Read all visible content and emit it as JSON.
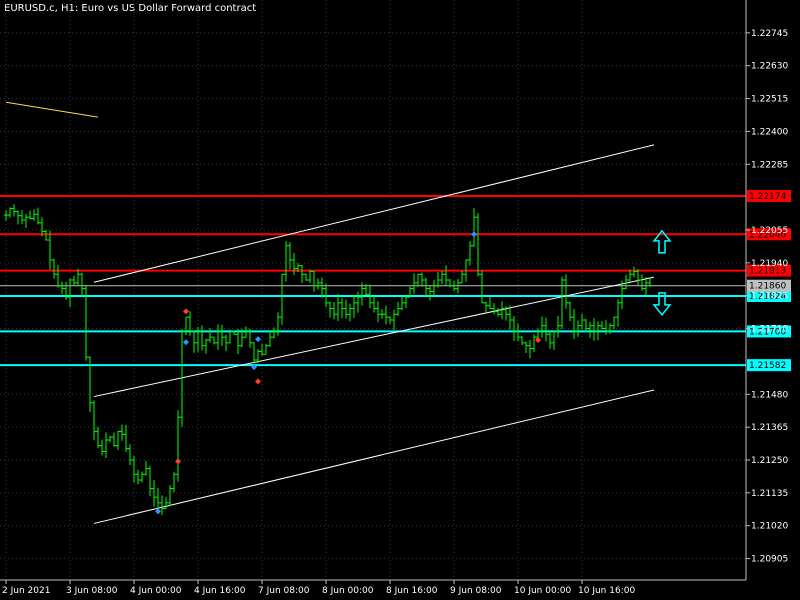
{
  "window": {
    "title": "EURUSD.c, H1:  Euro vs US Dollar Forward contract"
  },
  "colors": {
    "background": "#000000",
    "grid": "#3a3a3a",
    "candles": "#00ff00",
    "resistance": "#ff0000",
    "support": "#00ffff",
    "channel": "#ffffff",
    "bid": "#c0c0c0",
    "yellow_line": "#ffd54a",
    "arrow_up": "#00ffff",
    "arrow_down": "#00ffff",
    "fractal_up": "#ff4020",
    "fractal_down": "#3090ff"
  },
  "chart_data": {
    "type": "candlestick",
    "symbol": "EURUSD.c",
    "timeframe": "H1",
    "ylim": [
      1.2083,
      1.2286
    ],
    "y_ticks": [
      "1.22745",
      "1.22630",
      "1.22515",
      "1.22400",
      "1.22285",
      "1.22055",
      "1.21940",
      "1.21825",
      "1.21710",
      "1.21480",
      "1.21365",
      "1.21250",
      "1.21135",
      "1.21020",
      "1.20905"
    ],
    "x_ticks": [
      "2 Jun 2021",
      "3 Jun 08:00",
      "4 Jun 00:00",
      "4 Jun 16:00",
      "7 Jun 08:00",
      "8 Jun 00:00",
      "8 Jun 16:00",
      "9 Jun 08:00",
      "10 Jun 00:00",
      "10 Jun 16:00"
    ],
    "x_ticks_bars": [
      0,
      16,
      32,
      48,
      64,
      80,
      96,
      112,
      128,
      144
    ],
    "horizontal_levels": [
      {
        "value": 1.22174,
        "label": "1.22174",
        "kind": "resistance"
      },
      {
        "value": 1.2204,
        "label": "1.22040",
        "kind": "resistance"
      },
      {
        "value": 1.21913,
        "label": "1.21913",
        "kind": "resistance"
      },
      {
        "value": 1.21824,
        "label": "1.21824",
        "kind": "support"
      },
      {
        "value": 1.217,
        "label": "1.21700",
        "kind": "support"
      },
      {
        "value": 1.21582,
        "label": "1.21582",
        "kind": "support"
      }
    ],
    "current_price": {
      "value": 1.2186,
      "label": "1.21860"
    },
    "channel_lines": [
      {
        "bars": [
          22,
          162
        ],
        "values": [
          1.21872,
          1.22353
        ]
      },
      {
        "bars": [
          22,
          162
        ],
        "values": [
          1.21472,
          1.2189
        ]
      },
      {
        "bars": [
          22,
          162
        ],
        "values": [
          1.21028,
          1.21495
        ]
      }
    ],
    "yellow_line": {
      "bars": [
        0,
        23
      ],
      "values": [
        1.22502,
        1.2245
      ]
    },
    "arrows": [
      {
        "direction": "up",
        "bar": 164,
        "value": 1.2201
      },
      {
        "direction": "down",
        "bar": 164,
        "value": 1.218
      }
    ],
    "fractals_up": [
      {
        "bar": 45,
        "value": 1.2177
      },
      {
        "bar": 43,
        "value": 1.21245
      },
      {
        "bar": 63,
        "value": 1.21525
      },
      {
        "bar": 133,
        "value": 1.2167
      }
    ],
    "fractals_down": [
      {
        "bar": 38,
        "value": 1.2107
      },
      {
        "bar": 45,
        "value": 1.21662
      },
      {
        "bar": 62,
        "value": 1.21575
      },
      {
        "bar": 63,
        "value": 1.21673
      },
      {
        "bar": 117,
        "value": 1.2204
      }
    ],
    "closes": [
      1.22107,
      1.2213,
      1.2212,
      1.22105,
      1.2209,
      1.221,
      1.22095,
      1.2211,
      1.2208,
      1.2205,
      1.2202,
      1.2195,
      1.219,
      1.2186,
      1.2185,
      1.2182,
      1.2188,
      1.2187,
      1.219,
      1.2185,
      1.2161,
      1.2145,
      1.2135,
      1.213,
      1.2128,
      1.2132,
      1.2133,
      1.213,
      1.2135,
      1.2134,
      1.2129,
      1.2125,
      1.212,
      1.2118,
      1.212,
      1.2122,
      1.2115,
      1.2112,
      1.211,
      1.2108,
      1.211,
      1.2115,
      1.212,
      1.214,
      1.217,
      1.2175,
      1.217,
      1.2166,
      1.217,
      1.2165,
      1.2167,
      1.2168,
      1.2166,
      1.217,
      1.2168,
      1.2166,
      1.217,
      1.2169,
      1.2165,
      1.2168,
      1.217,
      1.2166,
      1.216,
      1.2163,
      1.2162,
      1.2165,
      1.2168,
      1.217,
      1.2175,
      1.219,
      1.22,
      1.2195,
      1.2192,
      1.2193,
      1.219,
      1.2188,
      1.2191,
      1.2186,
      1.2187,
      1.2185,
      1.218,
      1.2178,
      1.2176,
      1.218,
      1.2178,
      1.2176,
      1.2178,
      1.218,
      1.2182,
      1.2185,
      1.2183,
      1.218,
      1.2178,
      1.2176,
      1.2176,
      1.2175,
      1.2174,
      1.2176,
      1.2178,
      1.218,
      1.2182,
      1.2185,
      1.2187,
      1.219,
      1.2188,
      1.2185,
      1.2184,
      1.2186,
      1.2188,
      1.219,
      1.2188,
      1.2186,
      1.2185,
      1.2187,
      1.219,
      1.2195,
      1.22,
      1.221,
      1.219,
      1.218,
      1.2179,
      1.2178,
      1.2177,
      1.2176,
      1.2178,
      1.2176,
      1.2174,
      1.217,
      1.2168,
      1.2166,
      1.2165,
      1.2164,
      1.2168,
      1.217,
      1.2172,
      1.2169,
      1.2166,
      1.217,
      1.2172,
      1.2188,
      1.218,
      1.2175,
      1.217,
      1.2172,
      1.2174,
      1.2171,
      1.2172,
      1.217,
      1.2172,
      1.2171,
      1.217,
      1.2172,
      1.2175,
      1.218,
      1.2185,
      1.2188,
      1.219,
      1.2191,
      1.2188,
      1.2185,
      1.2187,
      1.2186
    ]
  }
}
